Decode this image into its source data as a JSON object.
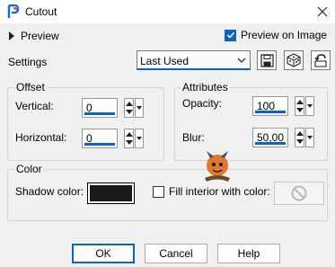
{
  "window": {
    "title": "Cutout"
  },
  "preview": {
    "label": "Preview",
    "preview_on_image_label": "Preview on Image",
    "preview_on_image_checked": true
  },
  "settings": {
    "label": "Settings",
    "selected": "Last Used"
  },
  "offset": {
    "group_label": "Offset",
    "vertical_label": "Vertical:",
    "vertical_value": "0",
    "horizontal_label": "Horizontal:",
    "horizontal_value": "0"
  },
  "attributes": {
    "group_label": "Attributes",
    "opacity_label": "Opacity:",
    "opacity_value": "100",
    "blur_label": "Blur:",
    "blur_value": "50,00"
  },
  "color": {
    "group_label": "Color",
    "shadow_color_label": "Shadow color:",
    "shadow_color": "#1a1a1c",
    "fill_interior_label": "Fill interior with color:",
    "fill_interior_checked": false
  },
  "buttons": {
    "ok": "OK",
    "cancel": "Cancel",
    "help": "Help"
  },
  "colors": {
    "accent": "#0a64c8",
    "background": "#f0f0f0"
  },
  "icons": [
    "app-logo-icon",
    "close-icon",
    "save-preset-icon",
    "randomize-icon",
    "reset-icon",
    "no-color-icon",
    "watermark-logo"
  ]
}
